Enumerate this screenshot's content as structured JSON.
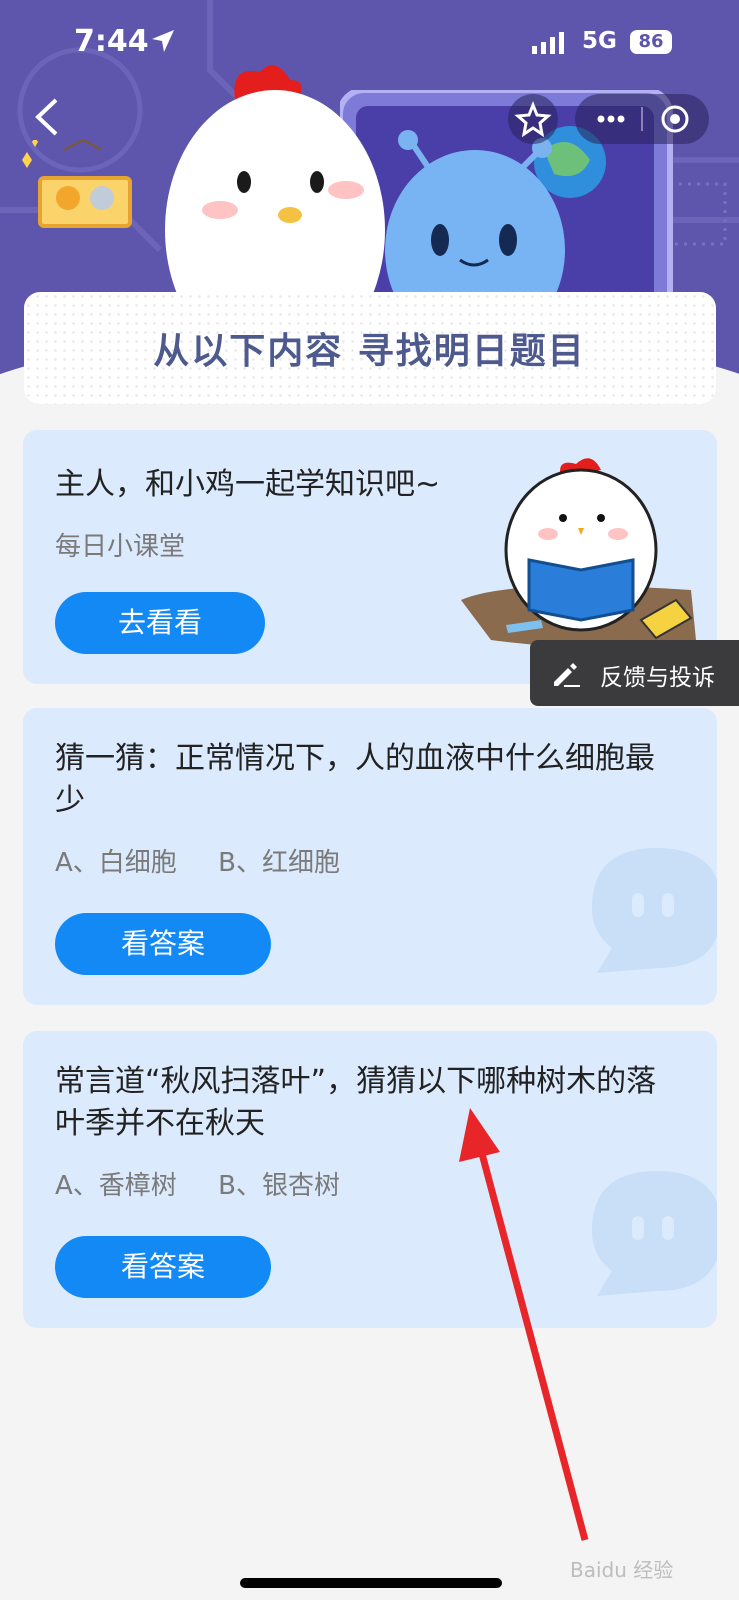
{
  "status_bar": {
    "time": "7:44",
    "network": "5G",
    "battery": "86"
  },
  "banner": {
    "title": "从以下内容 寻找明日题目"
  },
  "cards": [
    {
      "title": "主人，和小鸡一起学知识吧~",
      "subtitle": "每日小课堂",
      "button": "去看看"
    },
    {
      "title": "猜一猜：正常情况下，人的血液中什么细胞最少",
      "options": "A、白细胞     B、红细胞",
      "button": "看答案"
    },
    {
      "title": "常言道“秋风扫落叶”，猜猜以下哪种树木的落叶季并不在秋天",
      "options": "A、香樟树     B、银杏树",
      "button": "看答案"
    }
  ],
  "feedback": {
    "label": "反馈与投诉"
  },
  "watermark": "Baidu 经验",
  "colors": {
    "banner": "#5e56ad",
    "card": "#dbeafc",
    "button": "#1289f5",
    "annotation_arrow": "#e8262a"
  }
}
